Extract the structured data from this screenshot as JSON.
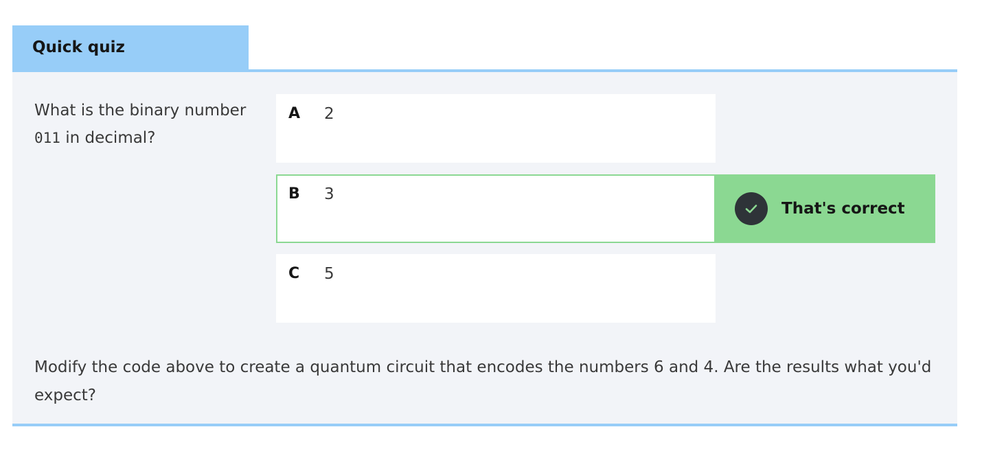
{
  "quiz": {
    "tab_title": "Quick quiz",
    "question": {
      "prefix": "What is the binary number ",
      "code": "011",
      "suffix": " in decimal?"
    },
    "options": [
      {
        "letter": "A",
        "text": "2"
      },
      {
        "letter": "B",
        "text": "3"
      },
      {
        "letter": "C",
        "text": "5"
      }
    ],
    "feedback": {
      "text": "That's correct",
      "icon": "check-circle-icon"
    },
    "prompt": "Modify the code above to create a quantum circuit that encodes the numbers 6 and 4. Are the results what you'd expect?",
    "colors": {
      "tab": "#97cdf8",
      "body": "#f2f4f8",
      "correct": "#8bd892",
      "icon_bg": "#2e3338"
    }
  }
}
